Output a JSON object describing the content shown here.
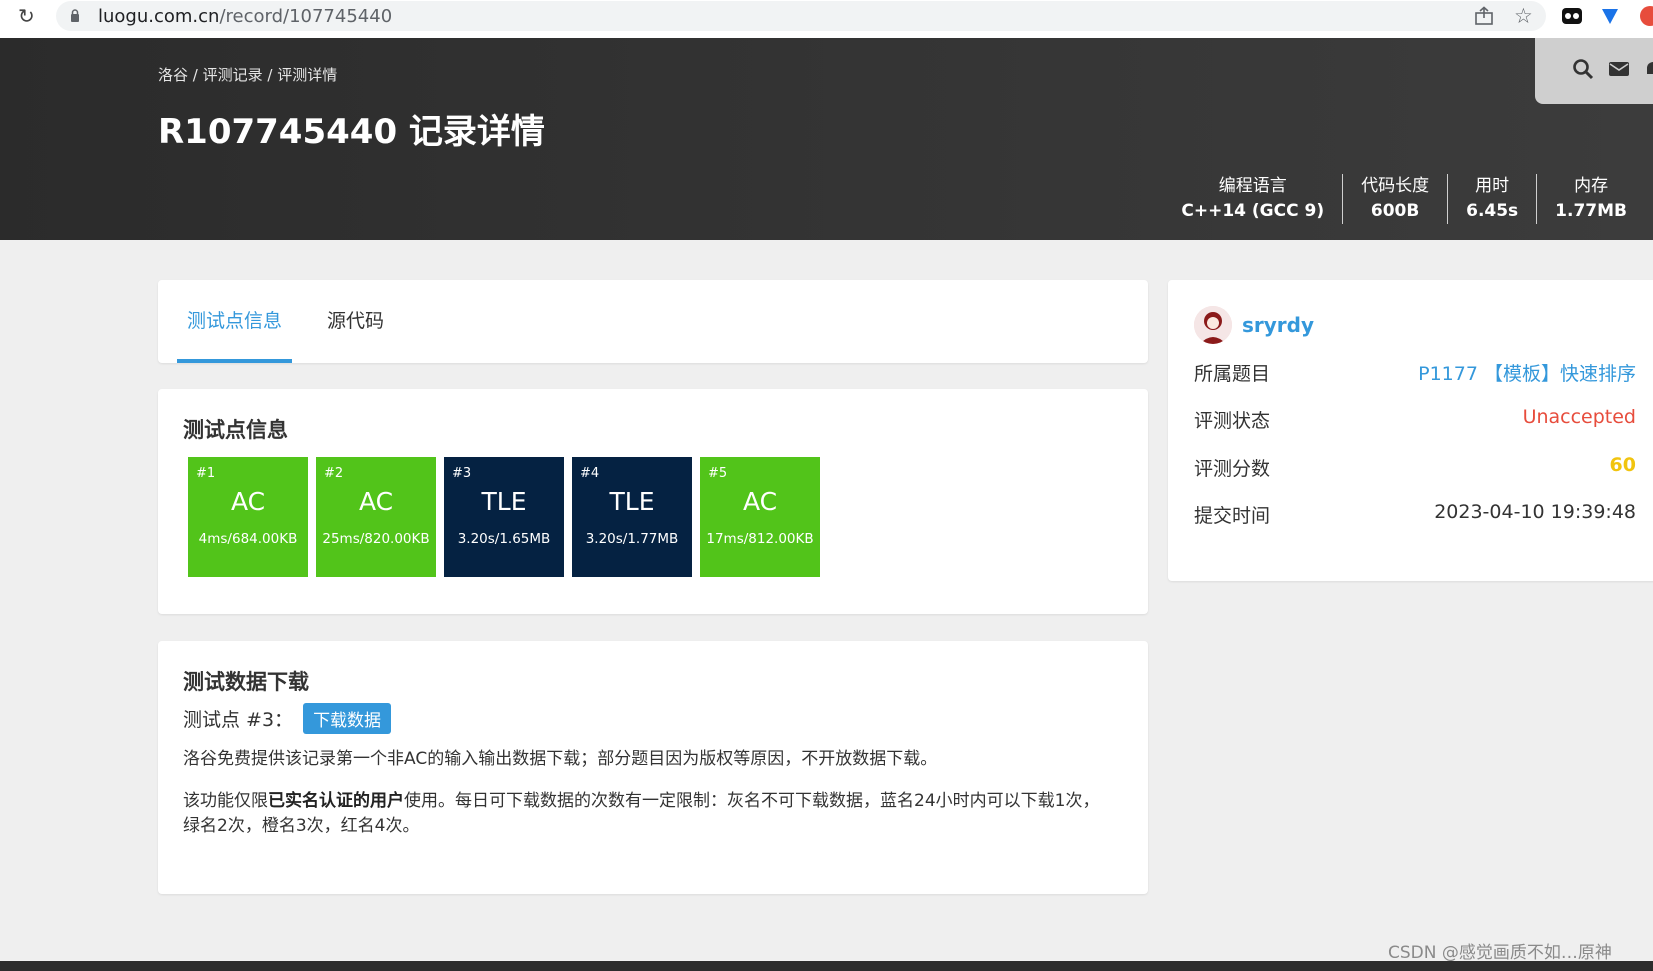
{
  "browser": {
    "url_host": "luogu.com.cn",
    "url_path": "/record/107745440"
  },
  "header": {
    "breadcrumb": [
      "洛谷",
      "评测记录",
      "评测详情"
    ],
    "breadcrumb_sep": " / ",
    "title": "R107745440 记录详情",
    "stats": [
      {
        "label": "编程语言",
        "value": "C++14 (GCC 9)"
      },
      {
        "label": "代码长度",
        "value": "600B"
      },
      {
        "label": "用时",
        "value": "6.45s"
      },
      {
        "label": "内存",
        "value": "1.77MB"
      }
    ]
  },
  "tabs": [
    {
      "label": "测试点信息",
      "active": true
    },
    {
      "label": "源代码",
      "active": false
    }
  ],
  "testcases": {
    "title": "测试点信息",
    "colors": {
      "AC": "#52c41a",
      "TLE": "#052242"
    },
    "items": [
      {
        "num": "#1",
        "result": "AC",
        "stats": "4ms/684.00KB"
      },
      {
        "num": "#2",
        "result": "AC",
        "stats": "25ms/820.00KB"
      },
      {
        "num": "#3",
        "result": "TLE",
        "stats": "3.20s/1.65MB"
      },
      {
        "num": "#4",
        "result": "TLE",
        "stats": "3.20s/1.77MB"
      },
      {
        "num": "#5",
        "result": "AC",
        "stats": "17ms/812.00KB"
      }
    ]
  },
  "download": {
    "title": "测试数据下载",
    "case_label": "测试点 #3：",
    "button": "下载数据",
    "para1": "洛谷免费提供该记录第一个非AC的输入输出数据下载；部分题目因为版权等原因，不开放数据下载。",
    "para2_pre": "该功能仅限",
    "para2_bold": "已实名认证的用户",
    "para2_post": "使用。每日可下载数据的次数有一定限制：灰名不可下载数据，蓝名24小时内可以下载1次，绿名2次，橙名3次，红名4次。"
  },
  "side": {
    "username": "sryrdy",
    "rows": [
      {
        "label": "所属题目",
        "value": "P1177 【模板】快速排序",
        "color": "#3498db"
      },
      {
        "label": "评测状态",
        "value": "Unaccepted",
        "color": "#e74c3c"
      },
      {
        "label": "评测分数",
        "value": "60",
        "color": "#f1c40f"
      },
      {
        "label": "提交时间",
        "value": "2023-04-10 19:39:48",
        "color": "#333333"
      }
    ]
  },
  "watermark": "CSDN @感觉画质不如…原神"
}
